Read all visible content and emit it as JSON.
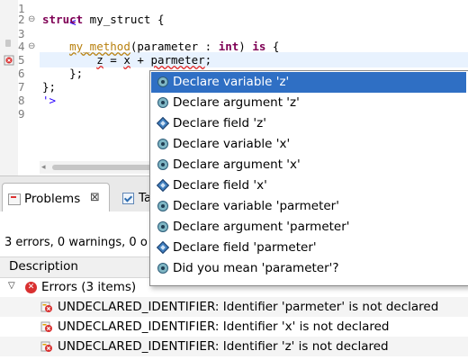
{
  "editor": {
    "lines": [
      {
        "num": "1",
        "text": "<'"
      },
      {
        "num": "2",
        "text": "struct my_struct {"
      },
      {
        "num": "3",
        "text": ""
      },
      {
        "num": "4",
        "text": "    my_method(parameter : int) is {"
      },
      {
        "num": "5",
        "text": "        z = x + parmeter;"
      },
      {
        "num": "6",
        "text": "    };"
      },
      {
        "num": "7",
        "text": "};"
      },
      {
        "num": "8",
        "text": "'>"
      },
      {
        "num": "9",
        "text": ""
      }
    ],
    "tokens": {
      "l1": "<'",
      "struct_kw": "struct",
      "struct_name": " my_struct {",
      "method_indent": "    ",
      "method_name": "my_method",
      "method_params_open": "(parameter : ",
      "type_int": "int",
      "method_params_close": ") ",
      "is_kw": "is",
      "method_brace": " {",
      "l5_indent": "        ",
      "var_z": "z",
      "l5_mid": " = ",
      "var_x": "x",
      "l5_plus": " + ",
      "var_parmeter": "parmeter",
      "l5_end": ";",
      "l6": "    };",
      "l7": "};",
      "l8": "'>"
    },
    "colors": {
      "keyword": "#7f0055",
      "string": "#2a00ff",
      "method": "#b8800e",
      "error": "#e02020",
      "current_line": "#e8f2fe"
    }
  },
  "tabs": {
    "problems_label": "Problems",
    "problems_close": "⊠",
    "tasks_label": "Ta"
  },
  "problems": {
    "summary": "3 errors, 0 warnings, 0 o",
    "column_description": "Description",
    "group": {
      "toggle": "▽",
      "label": "Errors (3 items)"
    },
    "items": [
      {
        "text": "UNDECLARED_IDENTIFIER: Identifier 'parmeter' is not declared"
      },
      {
        "text": "UNDECLARED_IDENTIFIER: Identifier 'x' is not declared"
      },
      {
        "text": "UNDECLARED_IDENTIFIER: Identifier 'z' is not declared"
      }
    ]
  },
  "quickfix": {
    "items": [
      {
        "label": "Declare variable 'z'",
        "icon": "variable-icon",
        "selected": true
      },
      {
        "label": "Declare argument 'z'",
        "icon": "argument-icon",
        "selected": false
      },
      {
        "label": "Declare field 'z'",
        "icon": "field-icon",
        "selected": false
      },
      {
        "label": "Declare variable 'x'",
        "icon": "variable-icon",
        "selected": false
      },
      {
        "label": "Declare argument 'x'",
        "icon": "argument-icon",
        "selected": false
      },
      {
        "label": "Declare field 'x'",
        "icon": "field-icon",
        "selected": false
      },
      {
        "label": "Declare variable 'parmeter'",
        "icon": "variable-icon",
        "selected": false
      },
      {
        "label": "Declare argument 'parmeter'",
        "icon": "argument-icon",
        "selected": false
      },
      {
        "label": "Declare field 'parmeter'",
        "icon": "field-icon",
        "selected": false
      },
      {
        "label": "Did you mean 'parameter'?",
        "icon": "suggestion-icon",
        "selected": false
      }
    ],
    "selected_color": "#2f6fc4"
  }
}
